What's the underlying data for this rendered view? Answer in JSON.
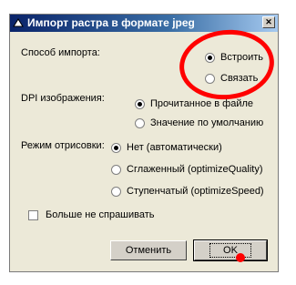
{
  "dialog": {
    "title": "Импорт растра в формате jpeg",
    "close_symbol": "✕"
  },
  "import_method": {
    "label": "Способ импорта:",
    "options": [
      {
        "label": "Встроить",
        "selected": true
      },
      {
        "label": "Связать",
        "selected": false
      }
    ]
  },
  "dpi": {
    "label": "DPI изображения:",
    "options": [
      {
        "label": "Прочитанное в файле",
        "selected": true
      },
      {
        "label": "Значение по умолчанию",
        "selected": false
      }
    ]
  },
  "render_mode": {
    "label": "Режим отрисовки:",
    "options": [
      {
        "label": "Нет (автоматически)",
        "selected": true
      },
      {
        "label": "Сглаженный (optimizeQuality)",
        "selected": false
      },
      {
        "label": "Ступенчатый (optimizeSpeed)",
        "selected": false
      }
    ]
  },
  "dont_ask": {
    "label": "Больше не спрашивать",
    "checked": false
  },
  "buttons": {
    "cancel": "Отменить",
    "ok": "OK"
  },
  "annotation_color": "#ff0000",
  "title_icon": "app-icon"
}
